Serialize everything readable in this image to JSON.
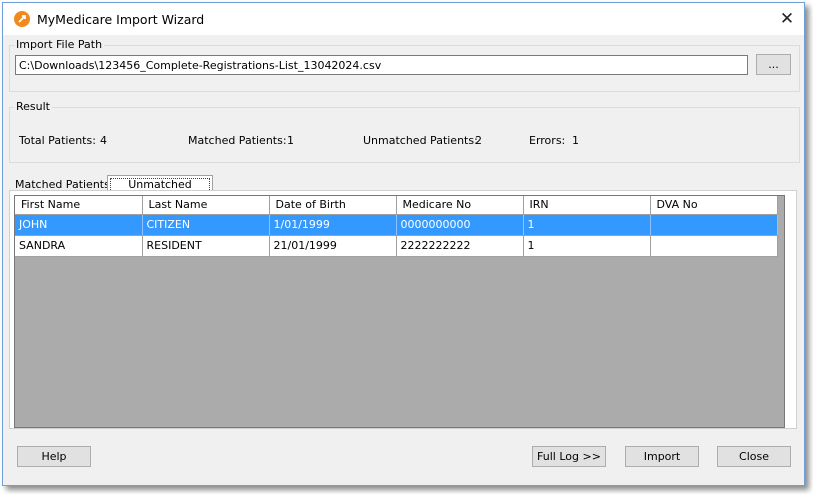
{
  "window": {
    "title": "MyMedicare Import Wizard"
  },
  "import_path": {
    "label": "Import File Path",
    "value": "C:\\Downloads\\123456_Complete-Registrations-List_13042024.csv",
    "browse_label": "..."
  },
  "result": {
    "label": "Result",
    "total_label": "Total Patients:",
    "total_value": "4",
    "matched_label": "Matched Patients:",
    "matched_value": "1",
    "unmatched_label": "Unmatched Patients:",
    "unmatched_value": "2",
    "errors_label": "Errors:",
    "errors_value": "1"
  },
  "tabs": [
    {
      "label": "Matched Patients",
      "active": false
    },
    {
      "label": "Unmatched Patients",
      "active": true
    }
  ],
  "grid": {
    "columns": [
      "First Name",
      "Last Name",
      "Date of Birth",
      "Medicare No",
      "IRN",
      "DVA No"
    ],
    "rows": [
      [
        "JOHN",
        "CITIZEN",
        "1/01/1999",
        "0000000000",
        "1",
        ""
      ],
      [
        "SANDRA",
        "RESIDENT",
        "21/01/1999",
        "2222222222",
        "1",
        ""
      ]
    ]
  },
  "buttons": {
    "help": "Help",
    "full_log": "Full Log >>",
    "import": "Import",
    "close": "Close"
  },
  "colors": {
    "selection": "#3399ff",
    "icon_accent": "#f08a1c"
  }
}
